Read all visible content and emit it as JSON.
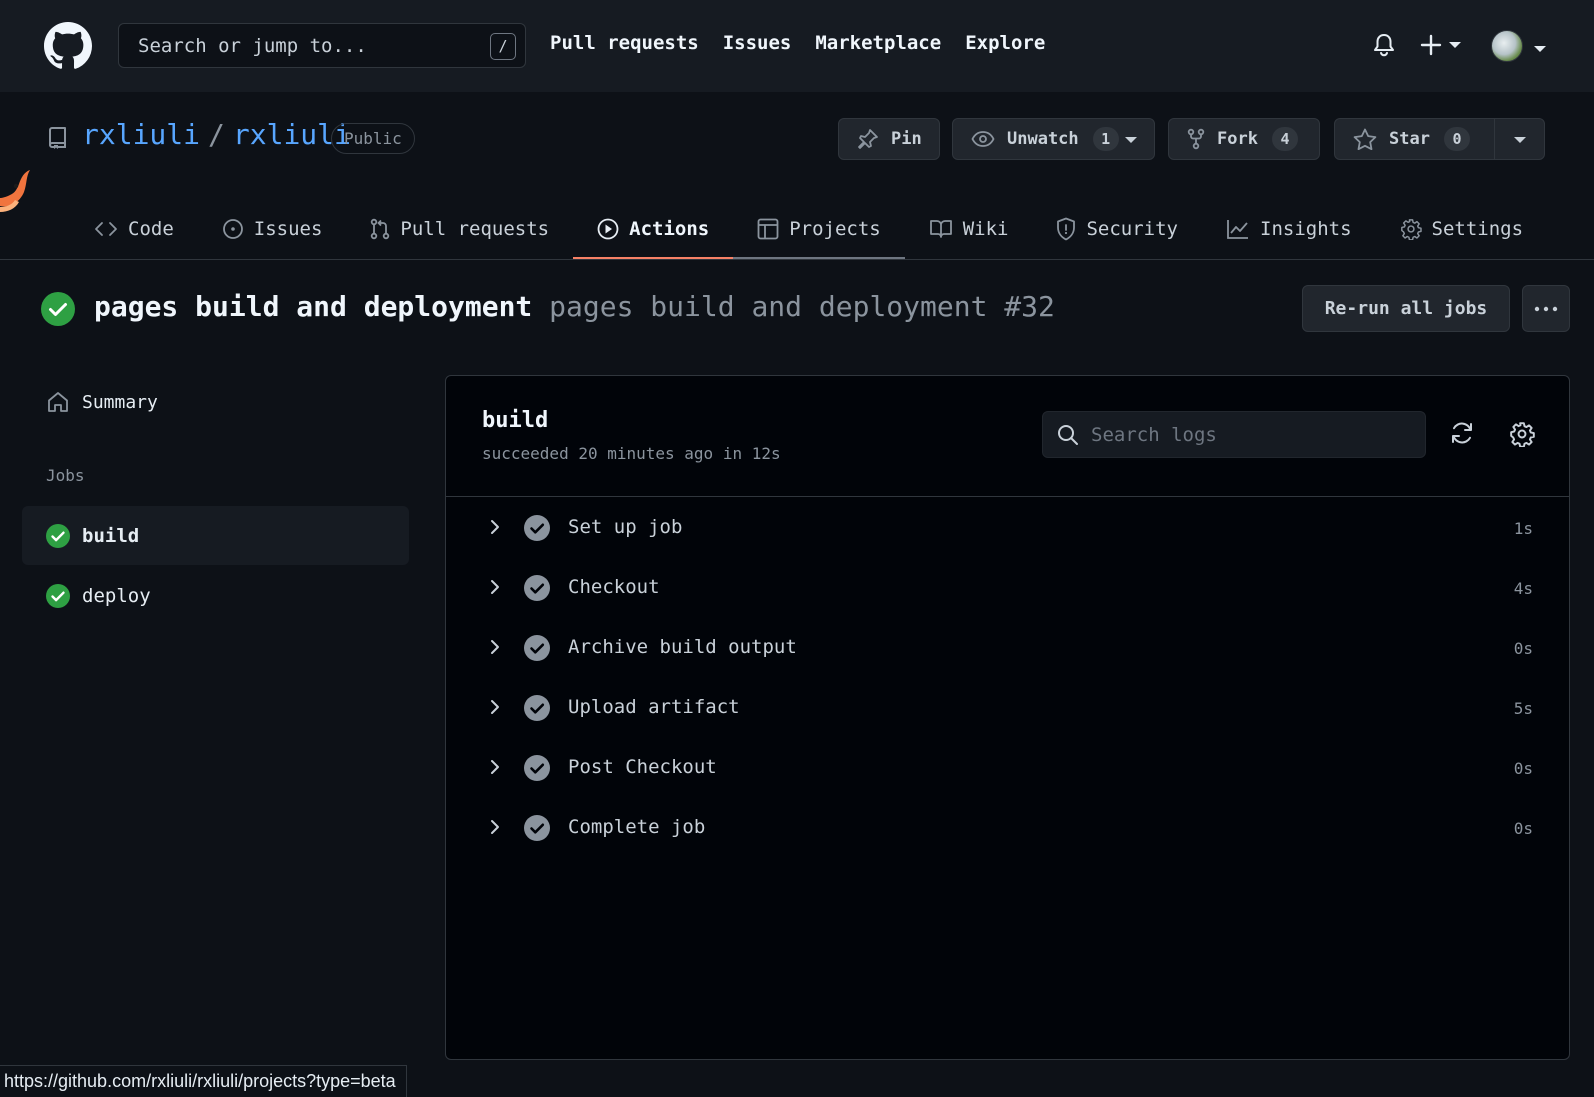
{
  "topbar": {
    "search_placeholder": "Search or jump to...",
    "search_shortcut": "/",
    "nav": [
      "Pull requests",
      "Issues",
      "Marketplace",
      "Explore"
    ]
  },
  "repo": {
    "owner": "rxliuli",
    "separator": "/",
    "name": "rxliuli",
    "visibility": "Public",
    "pin_label": "Pin",
    "unwatch_label": "Unwatch",
    "watch_count": "1",
    "fork_label": "Fork",
    "fork_count": "4",
    "star_label": "Star",
    "star_count": "0"
  },
  "tabs": [
    {
      "label": "Code",
      "icon": "code-icon"
    },
    {
      "label": "Issues",
      "icon": "issue-icon"
    },
    {
      "label": "Pull requests",
      "icon": "pull-request-icon"
    },
    {
      "label": "Actions",
      "icon": "play-icon",
      "active": true
    },
    {
      "label": "Projects",
      "icon": "table-icon"
    },
    {
      "label": "Wiki",
      "icon": "book-icon"
    },
    {
      "label": "Security",
      "icon": "shield-icon"
    },
    {
      "label": "Insights",
      "icon": "graph-icon"
    },
    {
      "label": "Settings",
      "icon": "gear-icon"
    }
  ],
  "run": {
    "workflow_name": "pages build and deployment",
    "run_name": "pages build and deployment #32",
    "rerun_label": "Re-run all jobs"
  },
  "sidebar": {
    "summary_label": "Summary",
    "jobs_heading": "Jobs",
    "jobs": [
      {
        "label": "build",
        "active": true
      },
      {
        "label": "deploy",
        "active": false
      }
    ]
  },
  "job": {
    "name": "build",
    "status": "succeeded 20 minutes ago in 12s",
    "search_placeholder": "Search logs",
    "steps": [
      {
        "name": "Set up job",
        "duration": "1s"
      },
      {
        "name": "Checkout",
        "duration": "4s"
      },
      {
        "name": "Archive build output",
        "duration": "0s"
      },
      {
        "name": "Upload artifact",
        "duration": "5s"
      },
      {
        "name": "Post Checkout",
        "duration": "0s"
      },
      {
        "name": "Complete job",
        "duration": "0s"
      }
    ]
  },
  "status_bar_url": "https://github.com/rxliuli/rxliuli/projects?type=beta",
  "colors": {
    "success": "#2ea043",
    "active_tab_underline": "#f78166",
    "link": "#58a6ff",
    "background": "#0d1117"
  }
}
